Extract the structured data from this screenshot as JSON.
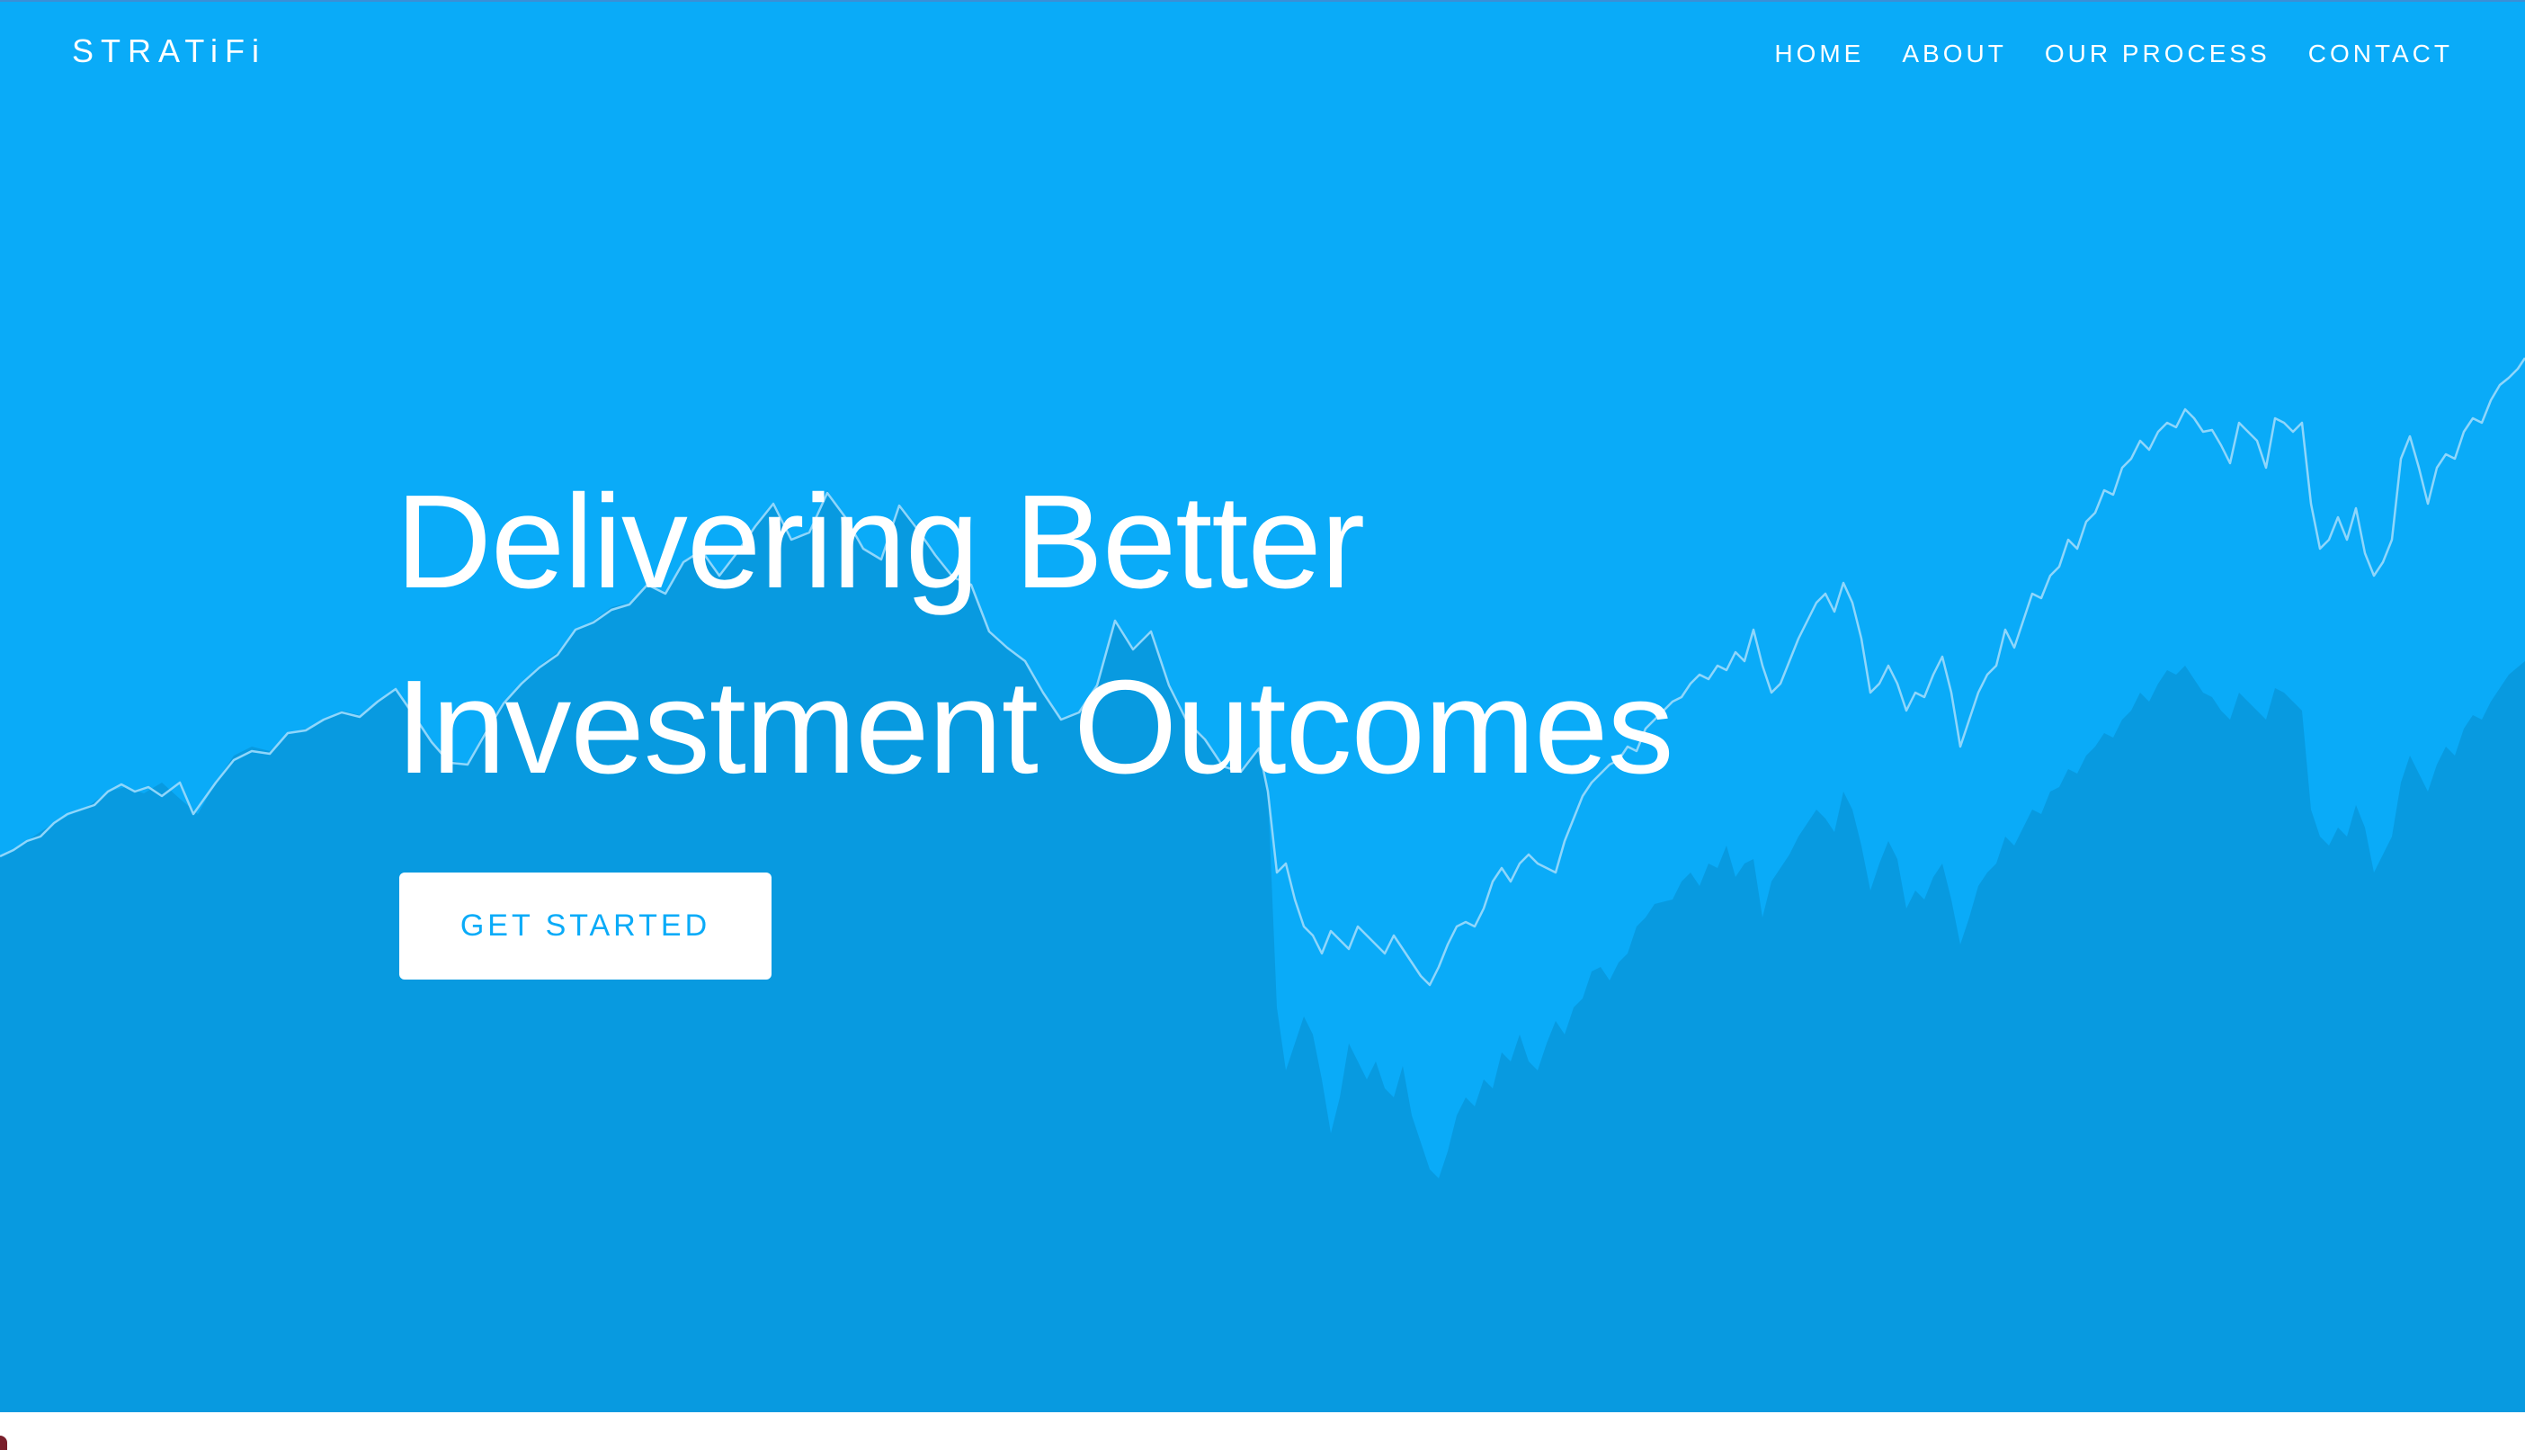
{
  "brand": {
    "logo_text": "STRATiFi"
  },
  "nav": {
    "items": [
      {
        "label": "HOME"
      },
      {
        "label": "ABOUT"
      },
      {
        "label": "OUR PROCESS"
      },
      {
        "label": "CONTACT"
      }
    ]
  },
  "hero": {
    "headline_line1": "Delivering Better",
    "headline_line2": "Investment Outcomes",
    "cta_label": "GET STARTED"
  },
  "colors": {
    "hero_background": "#0aabf8",
    "chart_area": "#089ae0",
    "chart_line": "#8fd6fb",
    "text": "#ffffff",
    "button_background": "#ffffff",
    "button_text": "#0aabf8"
  },
  "icons": {
    "background_chart": "decorative-stock-chart"
  }
}
